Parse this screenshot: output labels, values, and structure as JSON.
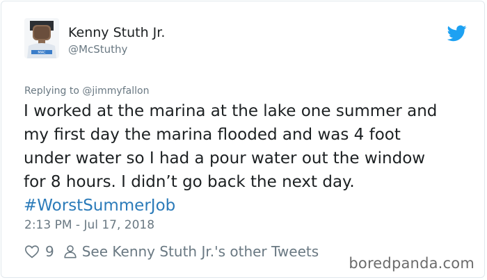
{
  "tweet": {
    "author": {
      "display_name": "Kenny Stuth Jr.",
      "handle": "@McStuthy"
    },
    "replying_to": "Replying to @jimmyfallon",
    "text_lines": [
      "I worked at the marina at the lake one summer and",
      "my first day the marina flooded and was 4 foot",
      "under water so I had a pour water out the window",
      "for 8 hours. I didn’t go back the next day."
    ],
    "hashtag": "#WorstSummerJob",
    "timestamp": "2:13 PM - Jul 17, 2018",
    "likes": "9",
    "profile_link": "See Kenny Stuth Jr.'s other Tweets"
  },
  "watermark": "boredpanda.com",
  "colors": {
    "link": "#2b7bb9",
    "twitter_blue": "#1da1f2",
    "muted": "#697882",
    "text": "#1c2022",
    "border": "#e1e8ed"
  },
  "icons": {
    "bird": "twitter-bird-icon",
    "like": "heart-icon",
    "profile": "person-icon"
  }
}
